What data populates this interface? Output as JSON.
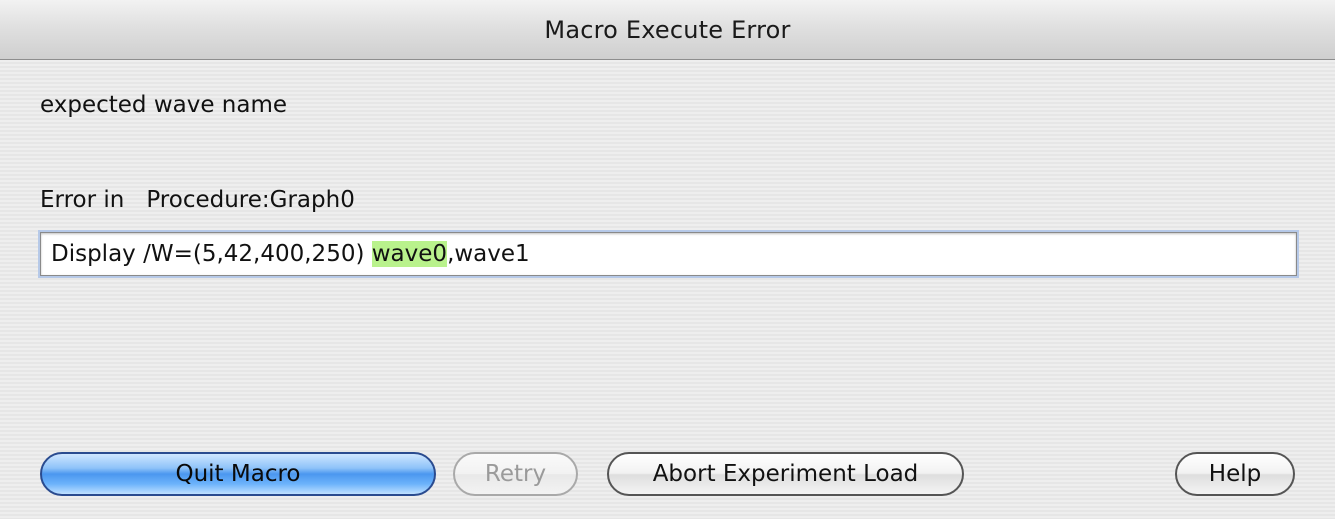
{
  "window": {
    "title": "Macro Execute Error"
  },
  "message": "expected wave name",
  "error": {
    "label": "Error in",
    "procedure": "Procedure:Graph0"
  },
  "command": {
    "before": "Display /W=(5,42,400,250) ",
    "highlighted": "wave0",
    "after": ",wave1",
    "highlight_color": "#b9f28c"
  },
  "buttons": {
    "quit_macro": "Quit Macro",
    "retry": "Retry",
    "abort_experiment_load": "Abort Experiment Load",
    "help": "Help"
  }
}
